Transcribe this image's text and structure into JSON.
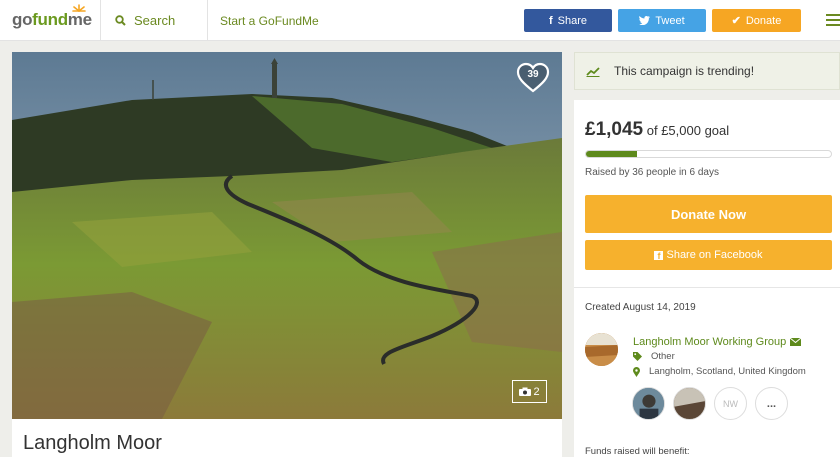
{
  "header": {
    "logo_prefix": "go",
    "logo_fund": "fund",
    "logo_suffix": "me",
    "search_label": "Search",
    "start_label": "Start a GoFundMe",
    "share_label": "Share",
    "tweet_label": "Tweet",
    "donate_label": "Donate",
    "icons": [
      "search-icon",
      "facebook-icon",
      "twitter-icon",
      "check-icon",
      "menu-icon"
    ],
    "colors": {
      "share": "#33589d",
      "tweet": "#45a3e5",
      "donate": "#f6a623",
      "brand": "#6b8a21"
    }
  },
  "hero": {
    "heart_count": "39",
    "photo_count": "2",
    "title": "Langholm Moor"
  },
  "sidebar": {
    "trending_text": "This campaign is trending!",
    "raised_amount": "£1,045",
    "goal_text": "of £5,000 goal",
    "progress_fraction": 0.209,
    "raised_by_text": "Raised by 36 people in 6 days",
    "donate_now_label": "Donate Now",
    "share_facebook_label": "Share on Facebook",
    "created_text": "Created August 14, 2019",
    "organizer_name": "Langholm Moor Working Group",
    "category": "Other",
    "location": "Langholm, Scotland, United Kingdom",
    "donor_initials": "NW",
    "more_label": "...",
    "funds_benefit_text": "Funds raised will benefit:",
    "colors": {
      "button": "#f6b12d",
      "progress": "#5e8a1c"
    }
  }
}
